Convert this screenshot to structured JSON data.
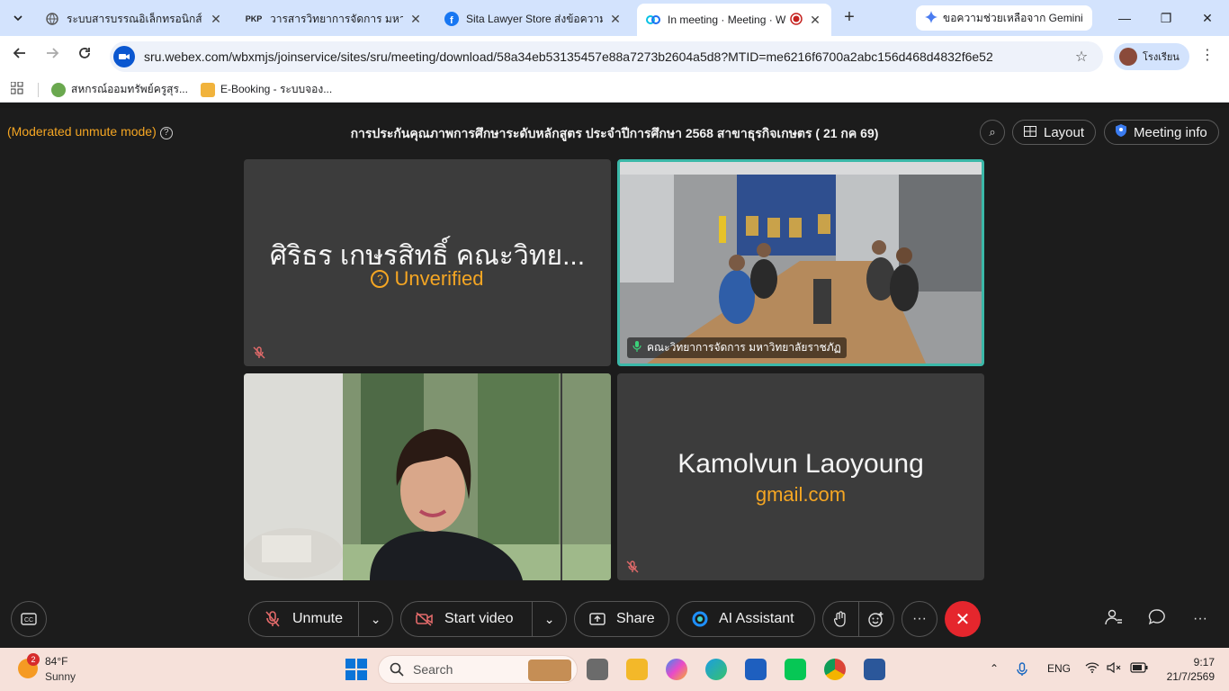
{
  "browser": {
    "tabs": [
      {
        "title": "ระบบสารบรรณอิเล็กทรอนิกส์",
        "favicon": "globe-icon"
      },
      {
        "title": "วารสารวิทยาการจัดการ มหาวิทยาลัย",
        "favicon": "pkp-icon",
        "favicon_text": "PKP"
      },
      {
        "title": "Sita Lawyer Store ส่งข้อความถึ",
        "favicon": "facebook-icon"
      },
      {
        "title": "In meeting · Meeting · W",
        "favicon": "webex-icon"
      }
    ],
    "gemini_tab": "ขอความช่วยเหลือจาก Gemini",
    "url": "sru.webex.com/wbxmjs/joinservice/sites/sru/meeting/download/58a34eb53135457e88a7273b2604a5d8?MTID=me6216f6700a2abc156d468d4832f6e52",
    "profile_name": "โรงเรียน",
    "bookmarks": [
      {
        "label": "สหกรณ์ออมทรัพย์ครูสุร...",
        "icon_color": "#6aa84f"
      },
      {
        "label": "E-Booking - ระบบจอง...",
        "icon_color": "#f1b33c"
      }
    ]
  },
  "meeting": {
    "mode_label": "(Moderated unmute mode)",
    "title": "การประกันคุณภาพการศึกษาระดับหลักสูตร ประจำปีการศึกษา 2568 สาขาธุรกิจเกษตร ( 21 กค 69)",
    "layout_label": "Layout",
    "info_label": "Meeting info",
    "tiles": [
      {
        "name": "ศิริธร เกษรสิทธิ์ คณะวิทย...",
        "sub": "Unverified"
      },
      {
        "label": "คณะวิทยาการจัดการ มหาวิทยาลัยราชภัฏ"
      },
      {},
      {
        "name": "Kamolvun Laoyoung",
        "sub": "gmail.com"
      }
    ],
    "controls": {
      "unmute": "Unmute",
      "start_video": "Start video",
      "share": "Share",
      "ai": "AI Assistant"
    }
  },
  "taskbar": {
    "weather_badge": "2",
    "temp": "84°F",
    "weather": "Sunny",
    "search": "Search",
    "lang": "ENG",
    "time": "9:17",
    "date": "21/7/2569"
  },
  "colors": {
    "accent_orange": "#f5a623",
    "active_speaker": "#3bb8a8",
    "end_red": "#e5262d"
  }
}
